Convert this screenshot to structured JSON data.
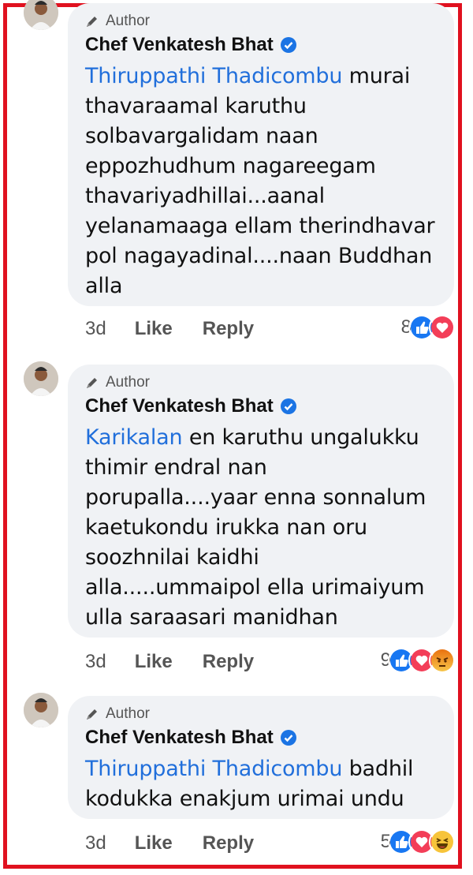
{
  "colors": {
    "mention": "#216fdb",
    "frame": "#e0111f",
    "bubble": "#f0f2f5"
  },
  "comments": [
    {
      "author_tag": "Author",
      "name": "Chef Venkatesh Bhat",
      "mention": "Thiruppathi Thadicombu",
      "text": " murai\nthavaraamal  karuthu\nsolbavargalidam naan\neppozhudhum nagareegam\nthavariyadhillai...aanal\nyelanamaaga ellam therindhavar\npol nagayadinal....naan Buddhan\nalla",
      "time": "3d",
      "like": "Like",
      "reply": "Reply",
      "reaction_count": "8",
      "reactions": [
        "like-icon",
        "love-icon"
      ]
    },
    {
      "author_tag": "Author",
      "name": "Chef Venkatesh Bhat",
      "mention": "Karikalan",
      "text": " en karuthu ungalukku\nthimir endral nan\nporupalla....yaar enna sonnalum\nkaetukondu irukka nan oru\nsoozhnilai kaidhi\nalla.....ummaipol ella urimaiyum\nulla saraasari manidhan",
      "time": "3d",
      "like": "Like",
      "reply": "Reply",
      "reaction_count": "9",
      "reactions": [
        "like-icon",
        "love-icon",
        "angry-icon"
      ]
    },
    {
      "author_tag": "Author",
      "name": "Chef Venkatesh Bhat",
      "mention": "Thiruppathi Thadicombu",
      "text": " badhil\nkodukka enakjum urimai undu",
      "time": "3d",
      "like": "Like",
      "reply": "Reply",
      "reaction_count": "5",
      "reactions": [
        "like-icon",
        "love-icon",
        "haha-icon"
      ]
    }
  ]
}
